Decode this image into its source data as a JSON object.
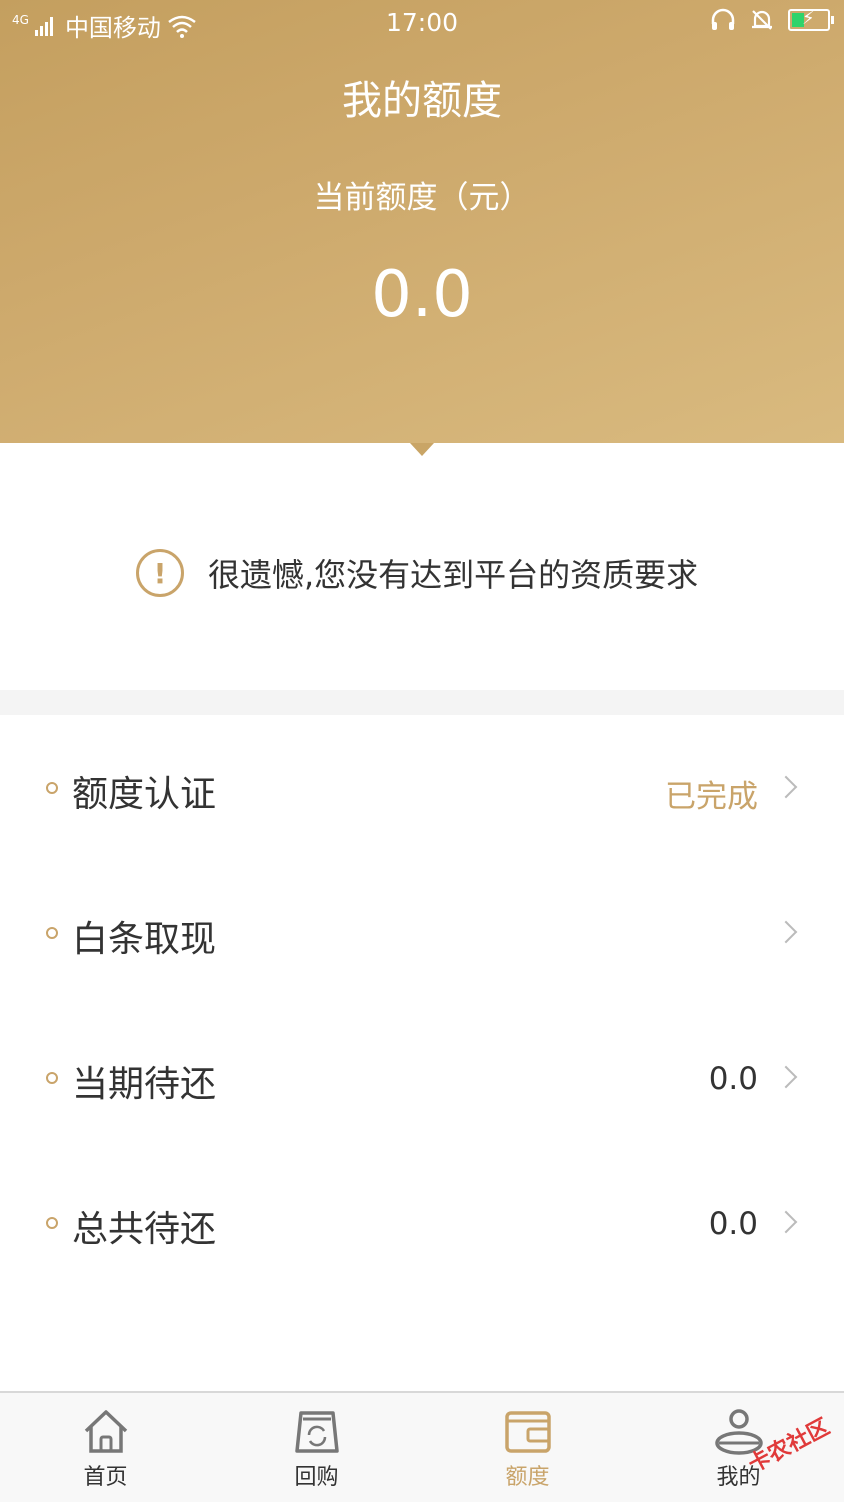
{
  "status_bar": {
    "network": "4G",
    "carrier": "中国移动",
    "time": "17:00"
  },
  "header": {
    "title": "我的额度",
    "quota_label": "当前额度（元）",
    "quota_value": "0.0"
  },
  "notice": {
    "text": "很遗憾,您没有达到平台的资质要求",
    "icon": "warning-circle-icon"
  },
  "menu": {
    "items": [
      {
        "label": "额度认证",
        "value": "已完成"
      },
      {
        "label": "白条取现",
        "value": ""
      },
      {
        "label": "当期待还",
        "value": "0.0"
      },
      {
        "label": "总共待还",
        "value": "0.0"
      }
    ]
  },
  "tabbar": {
    "tabs": [
      {
        "label": "首页",
        "icon": "home-icon"
      },
      {
        "label": "回购",
        "icon": "buyback-icon"
      },
      {
        "label": "额度",
        "icon": "wallet-icon",
        "active": true
      },
      {
        "label": "我的",
        "icon": "profile-icon"
      }
    ]
  },
  "watermark": "卡农社区",
  "colors": {
    "accent": "#c9a46a",
    "header_gradient_start": "#c49f5f",
    "header_gradient_end": "#d9ba7f"
  }
}
